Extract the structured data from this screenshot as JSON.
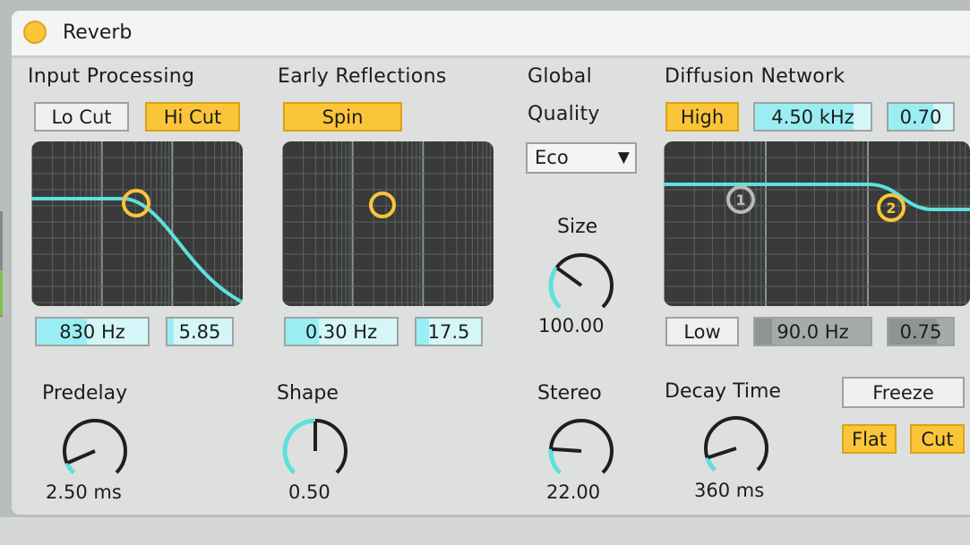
{
  "device": {
    "title": "Reverb"
  },
  "input_processing": {
    "header": "Input Processing",
    "lo_cut": "Lo Cut",
    "hi_cut": "Hi Cut",
    "freq": "830 Hz",
    "freq_level": 0.45,
    "width": "5.85",
    "width_level": 0.1
  },
  "early_reflections": {
    "header": "Early Reflections",
    "spin": "Spin",
    "rate": "0.30 Hz",
    "rate_level": 0.3,
    "amount": "17.5",
    "amount_level": 0.2
  },
  "global": {
    "header": "Global",
    "quality_label": "Quality",
    "quality_value": "Eco",
    "size_label": "Size",
    "size_value": "100.00",
    "size_level": 0.3,
    "stereo_label": "Stereo",
    "stereo_value": "22.00",
    "stereo_level": 0.18
  },
  "diffusion_network": {
    "header": "Diffusion Network",
    "high_label": "High",
    "high_freq": "4.50 kHz",
    "high_freq_level": 0.85,
    "high_amount": "0.70",
    "high_amount_level": 0.7,
    "low_label": "Low",
    "low_freq": "90.0 Hz",
    "low_freq_level": 0.15,
    "low_amount": "0.75",
    "low_amount_level": 0.75,
    "handle_1": "1",
    "handle_2": "2"
  },
  "predelay": {
    "label": "Predelay",
    "value": "2.50 ms",
    "level": 0.08
  },
  "shape": {
    "label": "Shape",
    "value": "0.50",
    "level": 0.5
  },
  "decay": {
    "label": "Decay Time",
    "value": "360 ms",
    "level": 0.1
  },
  "freeze": {
    "freeze_label": "Freeze",
    "flat_label": "Flat",
    "cut_label": "Cut"
  },
  "colors": {
    "accent": "#fbc53a",
    "curve": "#5fe0db",
    "display_bg": "#383b3a",
    "value_cyan": "#9aeef3"
  }
}
